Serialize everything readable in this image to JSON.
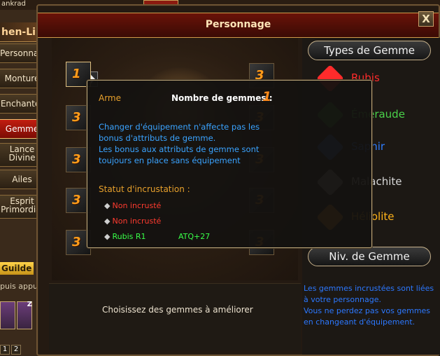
{
  "topbar": {
    "player_name": "ankrad"
  },
  "character": {
    "name": "hen-Li"
  },
  "sidebar": {
    "items": [
      {
        "label": "Personnage"
      },
      {
        "label": "Monture"
      },
      {
        "label": "Enchanter"
      },
      {
        "label": "Gemme",
        "active": true
      },
      {
        "label": "Lance Divine"
      },
      {
        "label": "Ailes"
      },
      {
        "label": "Esprit Primordial"
      }
    ],
    "guilde_tab": "Guilde",
    "guilde_tip": "puis appu",
    "portrait_levels": [
      "",
      "Z"
    ],
    "slot_numbers": [
      "1",
      "2"
    ]
  },
  "window": {
    "title": "Personnage",
    "close_label": "X",
    "bottom_message": "Choisissez des gemmes à améliorer",
    "slots_left": [
      "1",
      "3",
      "3",
      "3",
      "3"
    ],
    "slots_right": [
      "3",
      "3",
      "3",
      "3",
      "3"
    ]
  },
  "tooltip": {
    "item_type": "Arme",
    "count_label": "Nombre de gemmes :",
    "count_value": "1",
    "description": [
      "Changer d'équipement n'affecte pas les",
      "bonus d'attributs de gemme.",
      "Les bonus aux attributs de gemme sont",
      "toujours en place sans équipement"
    ],
    "status_title": "Statut d'incrustation :",
    "status_rows": [
      {
        "text": "Non incrusté",
        "color": "red",
        "bonus": ""
      },
      {
        "text": "Non incrusté",
        "color": "red",
        "bonus": ""
      },
      {
        "text": "Rubis R1",
        "color": "green",
        "bonus": "ATQ+27"
      }
    ]
  },
  "right_panel": {
    "types_title": "Types de Gemme",
    "gem_types": [
      {
        "label": "Rubis",
        "color": "#ff2b2b"
      },
      {
        "label": "Émeraude",
        "color": "#4ad14a"
      },
      {
        "label": "Saphir",
        "color": "#2f7dff"
      },
      {
        "label": "Malachite",
        "color": "#d8d8d8"
      },
      {
        "label": "Héliolite",
        "color": "#ffb31a"
      }
    ],
    "level_title": "Niv. de Gemme",
    "info": [
      "Les gemmes incrustées sont liées",
      "à votre personnage.",
      "Vous ne perdez pas vos gemmes",
      "en changeant d'équipement."
    ]
  }
}
